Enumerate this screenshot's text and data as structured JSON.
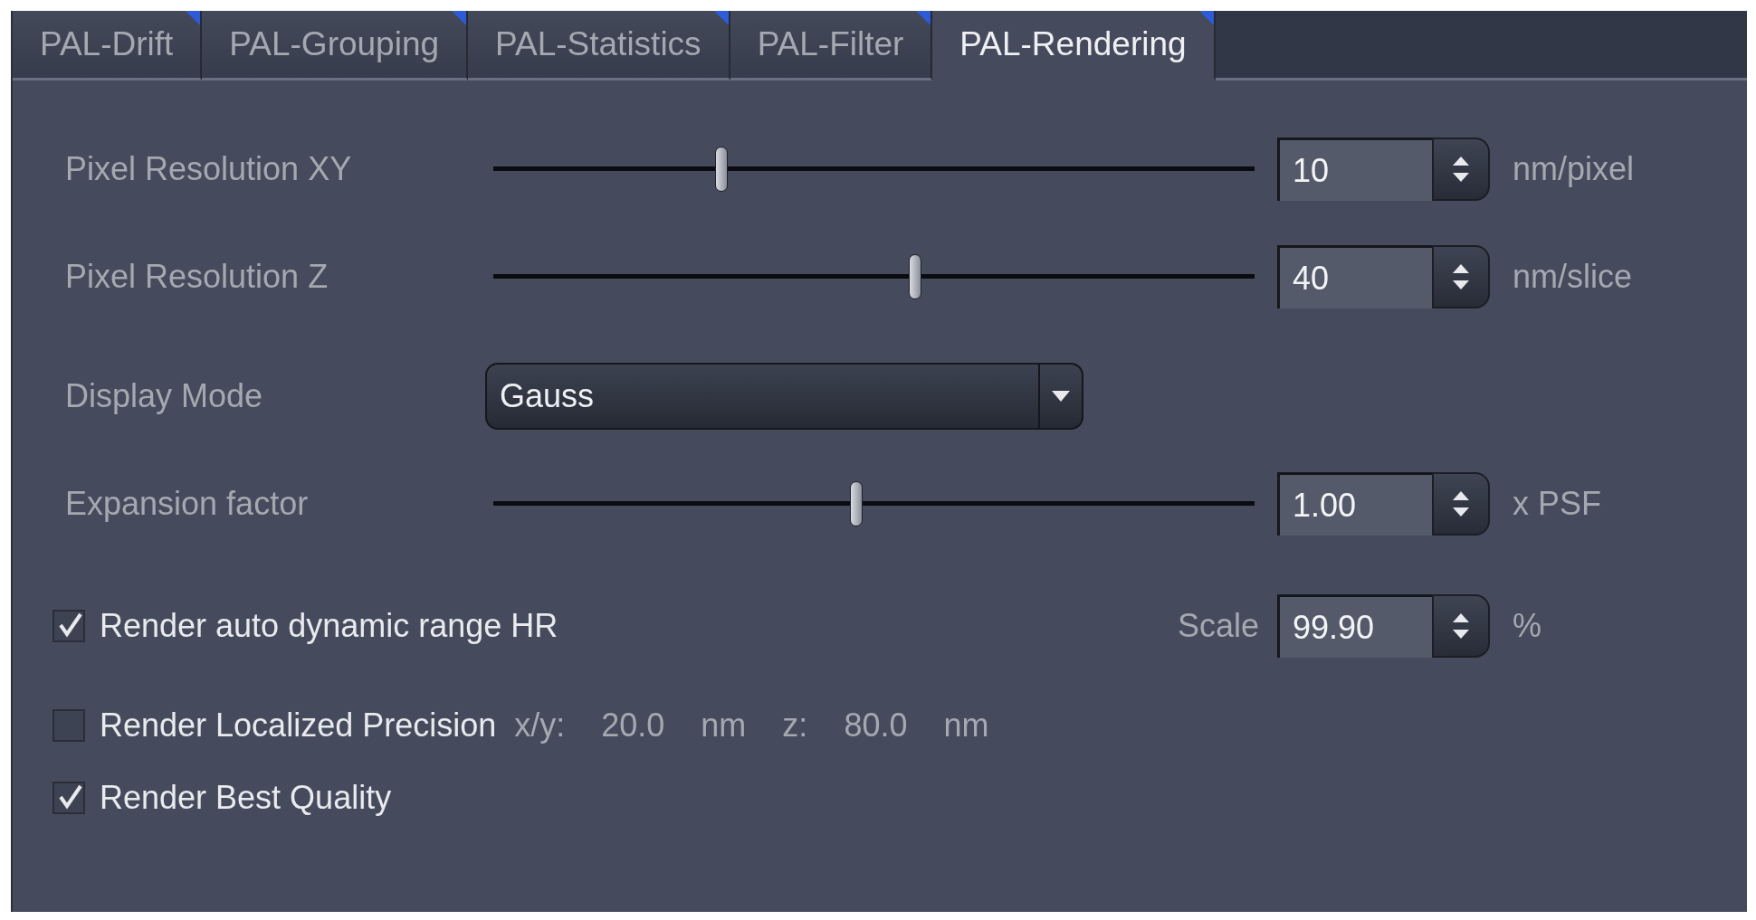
{
  "tabs": [
    {
      "label": "PAL-Drift",
      "selected": false
    },
    {
      "label": "PAL-Grouping",
      "selected": false
    },
    {
      "label": "PAL-Statistics",
      "selected": false
    },
    {
      "label": "PAL-Filter",
      "selected": false
    },
    {
      "label": "PAL-Rendering",
      "selected": true
    }
  ],
  "settings": [
    {
      "kind": "slider",
      "label": "Pixel Resolution XY",
      "level": 0.3,
      "value": "10",
      "unit": "nm/pixel"
    },
    {
      "kind": "slider",
      "label": "Pixel Resolution Z",
      "level": 0.554,
      "value": "40",
      "unit": "nm/slice"
    },
    {
      "kind": "dropdown",
      "label": "Display Mode",
      "value": "Gauss"
    },
    {
      "kind": "slider",
      "label": "Expansion factor",
      "level": 0.477,
      "value": "1.00",
      "unit": "x PSF"
    }
  ],
  "options": [
    {
      "kind": "scale",
      "label": "Render auto dynamic range HR",
      "checked": true,
      "scale_label": "Scale",
      "value": "99.90",
      "unit": "%"
    },
    {
      "kind": "precision",
      "label": "Render Localized Precision",
      "checked": false,
      "xy_label": "x/y:",
      "xy_value": "20.0",
      "xy_unit": "nm",
      "z_label": "z:",
      "z_value": "80.0",
      "z_unit": "nm"
    },
    {
      "kind": "plain",
      "label": "Render Best Quality",
      "checked": true
    }
  ]
}
